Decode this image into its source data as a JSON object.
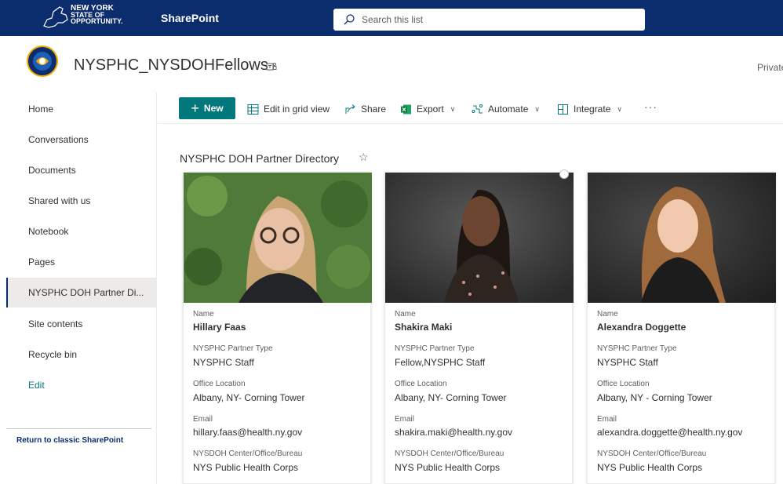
{
  "suite_bar": {
    "logo_text": [
      "NEW YORK",
      "STATE OF",
      "OPPORTUNITY."
    ],
    "app_name": "SharePoint",
    "search_placeholder": "Search this list",
    "bg_color": "#0b2d6e"
  },
  "site": {
    "title": "NYSPHC_NYSDOHFellows",
    "privacy": "Private group",
    "logo_icon": "public-health-corps-seal"
  },
  "nav": {
    "items": [
      {
        "label": "Home"
      },
      {
        "label": "Conversations"
      },
      {
        "label": "Documents"
      },
      {
        "label": "Shared with us"
      },
      {
        "label": "Notebook"
      },
      {
        "label": "Pages"
      },
      {
        "label": "NYSPHC DOH Partner Di..."
      },
      {
        "label": "Site contents"
      },
      {
        "label": "Recycle bin"
      },
      {
        "label": "Edit"
      }
    ],
    "active_index": 6,
    "classic_link": "Return to classic SharePoint"
  },
  "command_bar": {
    "new_label": "New",
    "edit_grid_label": "Edit in grid view",
    "share_label": "Share",
    "export_label": "Export",
    "automate_label": "Automate",
    "integrate_label": "Integrate",
    "more_label": "···",
    "accent": "#03787c"
  },
  "list": {
    "title": "NYSPHC DOH Partner Directory",
    "favorite_icon": "star-outline-icon"
  },
  "fields": {
    "name": "Name",
    "partner_type": "NYSPHC Partner Type",
    "office": "Office Location",
    "email": "Email",
    "center": "NYSDOH Center/Office/Bureau"
  },
  "cards": [
    {
      "name": "Hillary Faas",
      "partner_type": "NYSPHC Staff",
      "office": "Albany, NY- Corning Tower",
      "email": "hillary.faas@health.ny.gov",
      "center": "NYS Public Health Corps"
    },
    {
      "name": "Shakira Maki",
      "partner_type": "Fellow,NYSPHC Staff",
      "office": "Albany, NY- Corning Tower",
      "email": "shakira.maki@health.ny.gov",
      "center": "NYS Public Health Corps"
    },
    {
      "name": "Alexandra Doggette",
      "partner_type": "NYSPHC Staff",
      "office": "Albany, NY - Corning Tower",
      "email": "alexandra.doggette@health.ny.gov",
      "center": "NYS Public Health Corps"
    }
  ]
}
